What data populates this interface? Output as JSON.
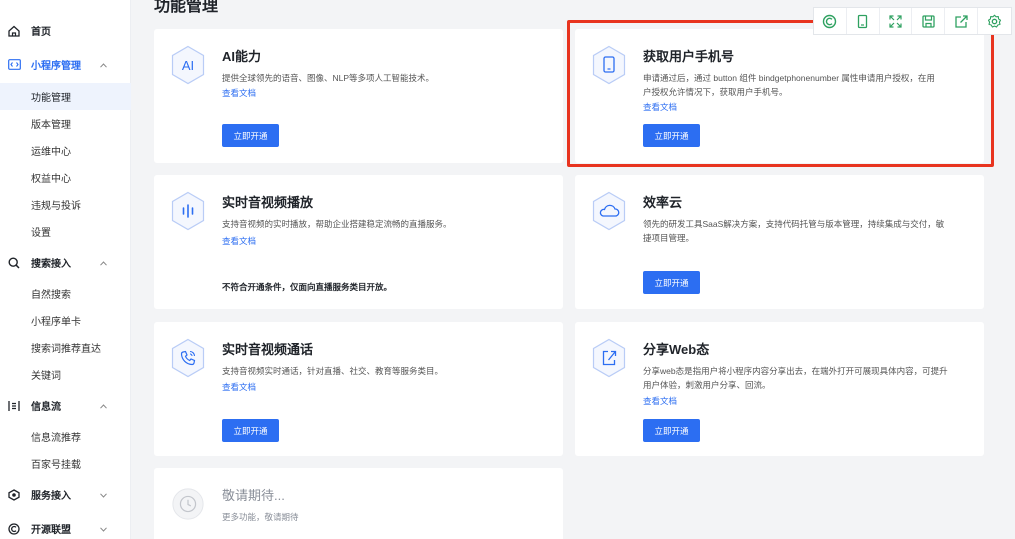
{
  "sidebar": {
    "home": "首页",
    "miniapp": "小程序管理",
    "miniapp_items": [
      "功能管理",
      "版本管理",
      "运维中心",
      "权益中心",
      "违规与投诉",
      "设置"
    ],
    "search": "搜索接入",
    "search_items": [
      "自然搜索",
      "小程序单卡",
      "搜索词推荐直达",
      "关键词"
    ],
    "feed": "信息流",
    "feed_items": [
      "信息流推荐",
      "百家号挂载"
    ],
    "service": "服务接入",
    "open": "开源联盟"
  },
  "page": {
    "title": "功能管理"
  },
  "cards": {
    "ai": {
      "icon_text": "AI",
      "title": "AI能力",
      "desc": "提供全球领先的语音、图像、NLP等多项人工智能技术。",
      "doc": "查看文档",
      "button": "立即开通"
    },
    "phone": {
      "title": "获取用户手机号",
      "desc1": "申请通过后，通过 button 组件 bindgetphonenumber 属性申请用户授权，在用",
      "desc2": "户授权允许情况下，获取用户手机号。",
      "doc": "查看文档",
      "button": "立即开通"
    },
    "live": {
      "title": "实时音视频播放",
      "desc": "支持音视频的实时播放，帮助企业搭建稳定流畅的直播服务。",
      "doc": "查看文档",
      "notice": "不符合开通条件，仅面向直播服务类目开放。"
    },
    "cloud": {
      "title": "效率云",
      "desc1": "领先的研发工具SaaS解决方案，支持代码托管与版本管理，持续集成与交付，敏",
      "desc2": "捷项目管理。",
      "button": "立即开通"
    },
    "call": {
      "title": "实时音视频通话",
      "desc": "支持音视频实时通话，针对直播、社交、教育等服务类目。",
      "doc": "查看文档",
      "button": "立即开通"
    },
    "share": {
      "title": "分享Web态",
      "desc1": "分享web态是指用户将小程序内容分享出去，在端外打开可展现具体内容，可提升",
      "desc2": "用户体验，刺激用户分享、回流。",
      "doc": "查看文档",
      "button": "立即开通"
    },
    "soon": {
      "title": "敬请期待...",
      "desc": "更多功能，敬请期待"
    }
  },
  "colors": {
    "primary": "#2c6ef2",
    "highlight": "#e8341f",
    "toolbar_icon": "#2ea160"
  },
  "toolbar_icons": [
    "refresh-icon",
    "phone-icon",
    "expand-icon",
    "save-icon",
    "share-icon",
    "settings-icon"
  ]
}
